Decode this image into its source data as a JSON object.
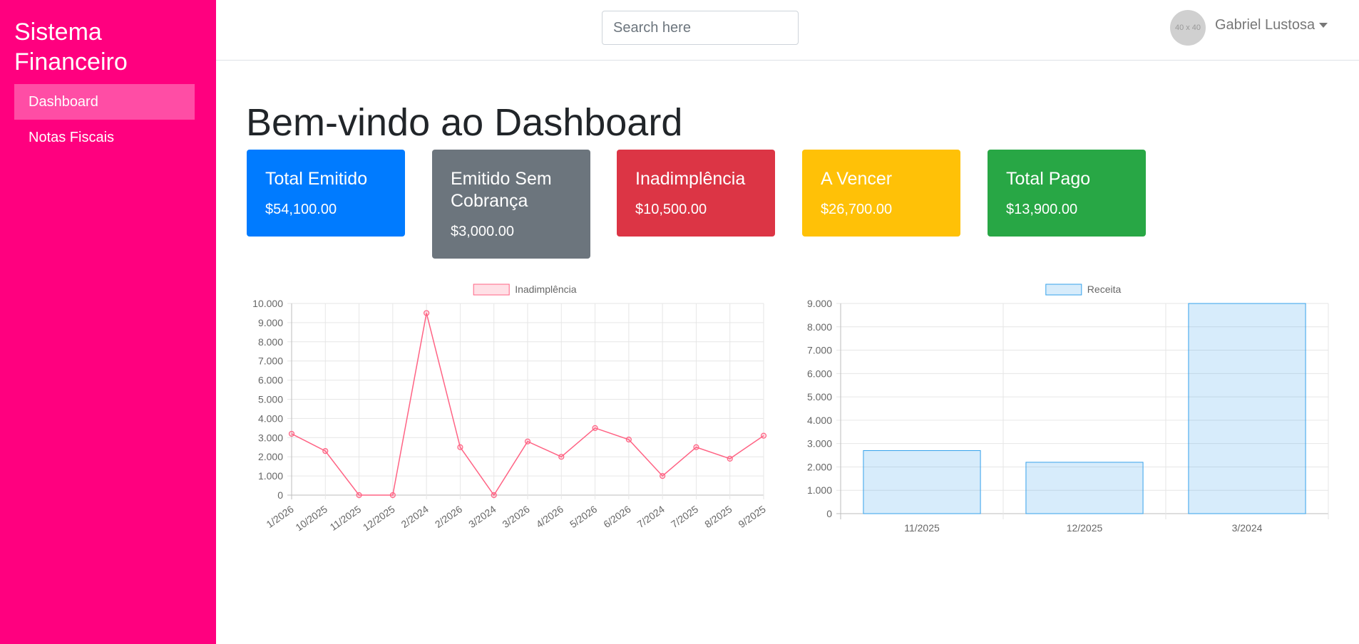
{
  "sidebar": {
    "brand": "Sistema Financeiro",
    "items": [
      {
        "label": "Dashboard",
        "active": true
      },
      {
        "label": "Notas Fiscais",
        "active": false
      }
    ],
    "color": "#ff007f"
  },
  "header": {
    "search_placeholder": "Search here",
    "avatar_text": "40 x 40",
    "user_name": "Gabriel Lustosa"
  },
  "main": {
    "title": "Bem-vindo ao Dashboard",
    "cards": [
      {
        "title": "Total Emitido",
        "value": "$54,100.00",
        "color": "#007bff"
      },
      {
        "title": "Emitido Sem Cobrança",
        "value": "$3,000.00",
        "color": "#6c757d"
      },
      {
        "title": "Inadimplência",
        "value": "$10,500.00",
        "color": "#dc3545"
      },
      {
        "title": "A Vencer",
        "value": "$26,700.00",
        "color": "#ffc107"
      },
      {
        "title": "Total Pago",
        "value": "$13,900.00",
        "color": "#28a745"
      }
    ]
  },
  "chart_data": [
    {
      "type": "line",
      "categories": [
        "1/2026",
        "10/2025",
        "11/2025",
        "12/2025",
        "2/2024",
        "2/2026",
        "3/2024",
        "3/2026",
        "4/2026",
        "5/2026",
        "6/2026",
        "7/2024",
        "7/2025",
        "8/2025",
        "9/2025"
      ],
      "series": [
        {
          "name": "Inadimplência",
          "values": [
            3200,
            2300,
            0,
            0,
            9500,
            2500,
            0,
            2800,
            2000,
            3500,
            2900,
            1000,
            2500,
            1900,
            3100
          ],
          "color": "#ff6384"
        }
      ],
      "ylim": [
        0,
        10000
      ],
      "yticks": [
        "0",
        "1.000",
        "2.000",
        "3.000",
        "4.000",
        "5.000",
        "6.000",
        "7.000",
        "8.000",
        "9.000",
        "10.000"
      ],
      "legend": "top",
      "grid": true
    },
    {
      "type": "bar",
      "categories": [
        "11/2025",
        "12/2025",
        "3/2024"
      ],
      "series": [
        {
          "name": "Receita",
          "values": [
            2700,
            2200,
            9000
          ],
          "color": "#36a2eb"
        }
      ],
      "ylim": [
        0,
        9000
      ],
      "yticks": [
        "0",
        "1.000",
        "2.000",
        "3.000",
        "4.000",
        "5.000",
        "6.000",
        "7.000",
        "8.000",
        "9.000"
      ],
      "legend": "top",
      "grid": true
    }
  ]
}
